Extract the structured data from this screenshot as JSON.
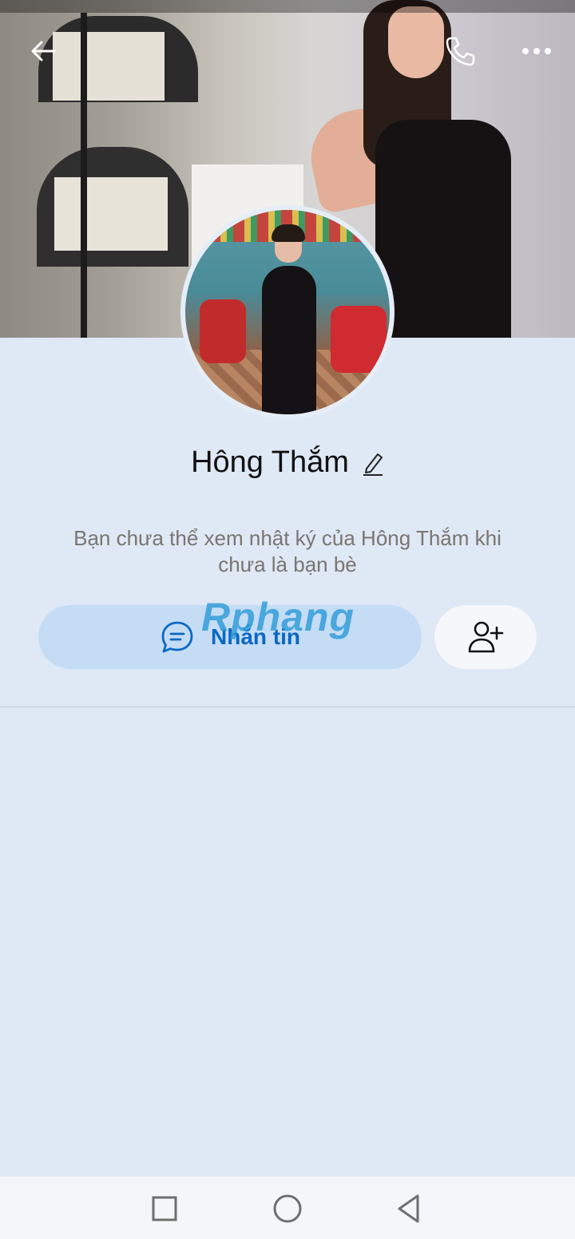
{
  "profile": {
    "name": "Hông Thắm",
    "note": "Bạn chưa thể xem nhật ký của Hông Thắm khi chưa là bạn bè"
  },
  "actions": {
    "message_label": "Nhắn tin"
  },
  "watermark": {
    "text": "Rphang"
  },
  "icons": {
    "back": "arrow-left-icon",
    "call": "phone-icon",
    "more": "more-dots-icon",
    "edit": "pencil-icon",
    "message": "chat-bubble-icon",
    "add_friend": "add-user-icon",
    "nav_recent": "square-icon",
    "nav_home": "circle-icon",
    "nav_back": "triangle-back-icon"
  },
  "colors": {
    "background": "#dfe8f5",
    "accent": "#0a68c4",
    "message_button_bg": "#c5dcf5"
  }
}
